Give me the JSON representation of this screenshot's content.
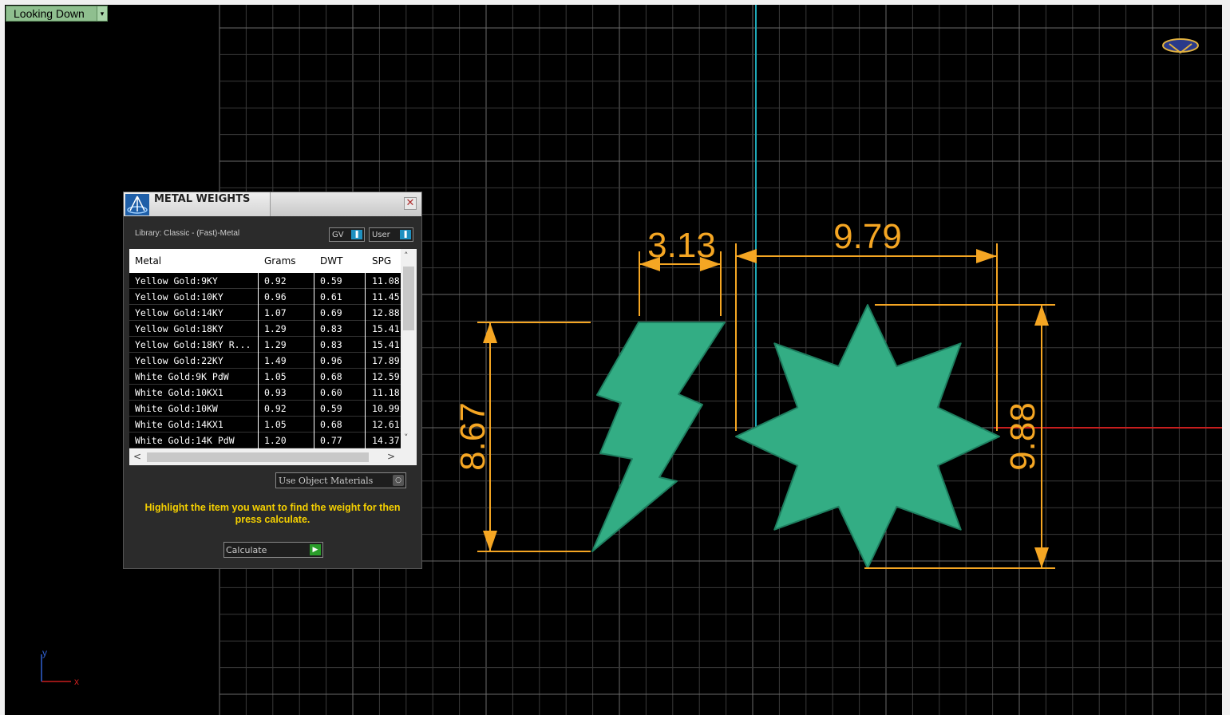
{
  "viewport": {
    "view_label": "Looking Down",
    "dropdown_glyph": "▾",
    "axis_x": "x",
    "axis_y": "y",
    "background": "#000000",
    "shape_color": "#33ad84",
    "dimension_color": "#f5a623"
  },
  "dimensions": {
    "width_bolt": "3.13",
    "width_star": "9.79",
    "height_bolt": "8.67",
    "height_star": "9.88"
  },
  "metal_weights": {
    "title": "METAL WEIGHTS",
    "close_glyph": "✕",
    "library": "Library: Classic - (Fast)-Metal",
    "toggle_gv": "GV",
    "toggle_user": "User",
    "toggle_glyph": "❚",
    "columns": [
      "Metal",
      "Grams",
      "DWT",
      "SPG"
    ],
    "rows": [
      {
        "metal": "Yellow Gold:9KY",
        "grams": "0.92",
        "dwt": "0.59",
        "spg": "11.08"
      },
      {
        "metal": "Yellow Gold:10KY",
        "grams": "0.96",
        "dwt": "0.61",
        "spg": "11.45"
      },
      {
        "metal": "Yellow Gold:14KY",
        "grams": "1.07",
        "dwt": "0.69",
        "spg": "12.88"
      },
      {
        "metal": "Yellow Gold:18KY",
        "grams": "1.29",
        "dwt": "0.83",
        "spg": "15.41"
      },
      {
        "metal": "Yellow Gold:18KY R...",
        "grams": "1.29",
        "dwt": "0.83",
        "spg": "15.41"
      },
      {
        "metal": "Yellow Gold:22KY",
        "grams": "1.49",
        "dwt": "0.96",
        "spg": "17.89"
      },
      {
        "metal": "White Gold:9K PdW",
        "grams": "1.05",
        "dwt": "0.68",
        "spg": "12.59"
      },
      {
        "metal": "White Gold:10KX1",
        "grams": "0.93",
        "dwt": "0.60",
        "spg": "11.18"
      },
      {
        "metal": "White Gold:10KW",
        "grams": "0.92",
        "dwt": "0.59",
        "spg": "10.99"
      },
      {
        "metal": "White Gold:14KX1",
        "grams": "1.05",
        "dwt": "0.68",
        "spg": "12.61"
      },
      {
        "metal": "White Gold:14K PdW",
        "grams": "1.20",
        "dwt": "0.77",
        "spg": "14.37"
      }
    ],
    "scroll_up": "˄",
    "scroll_down": "˅",
    "scroll_left": "<",
    "scroll_right": ">",
    "use_object_materials": "Use Object Materials",
    "use_object_glyph": "○",
    "hint": "Highlight the item you want to find the weight for then press calculate.",
    "calculate_label": "Calculate",
    "calculate_glyph": "▶"
  }
}
